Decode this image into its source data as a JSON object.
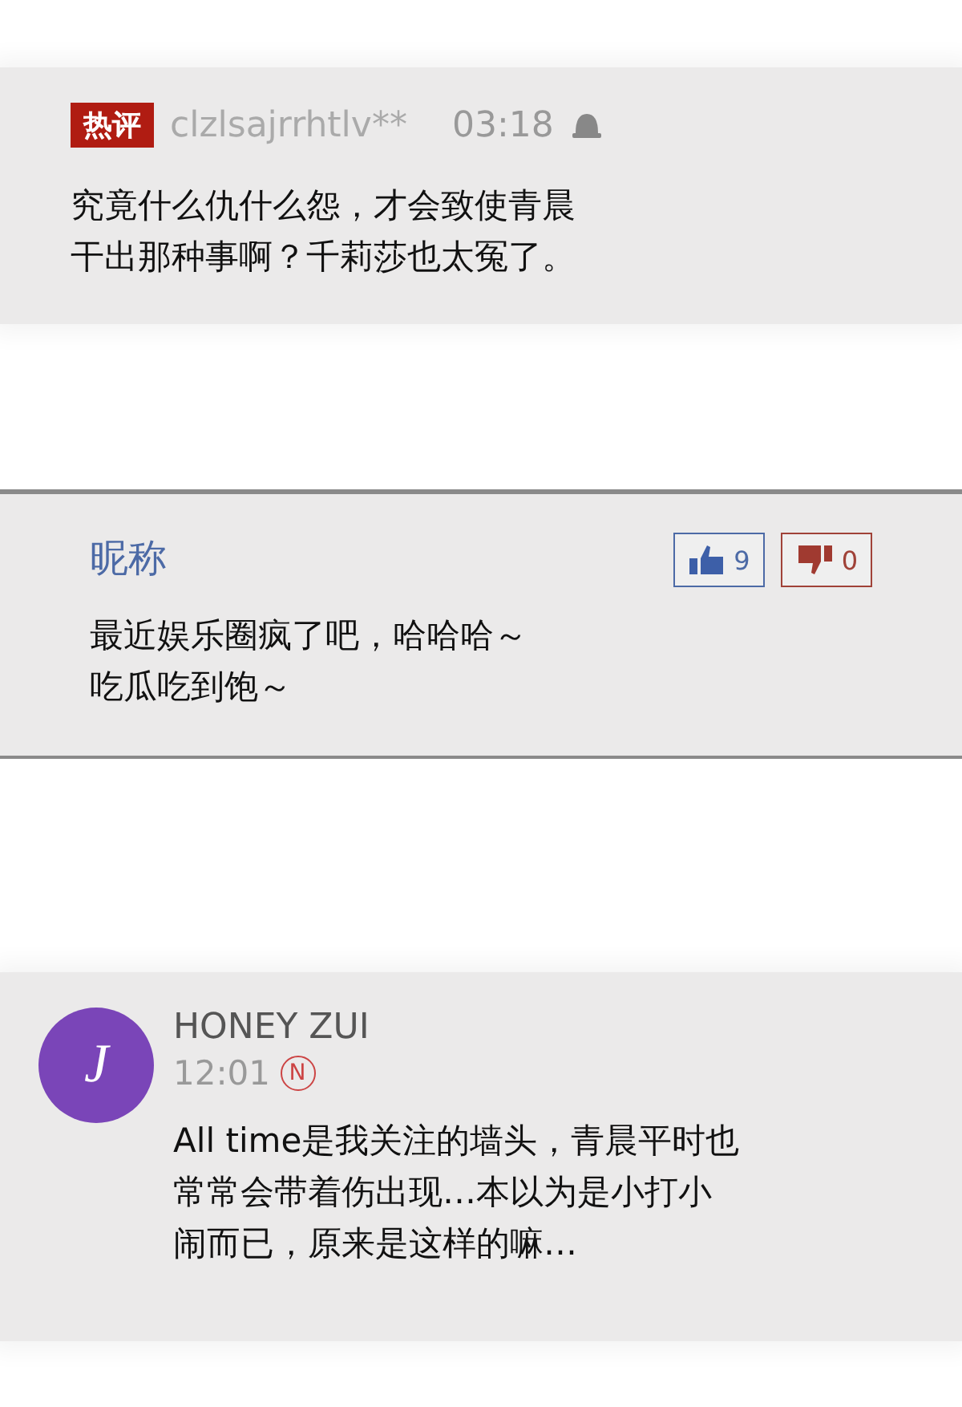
{
  "comments": [
    {
      "kind": "hot",
      "badge": "热评",
      "user": "clzlsajrrhtlv**",
      "time": "03:18",
      "text": "究竟什么仇什么怨，才会致使青晨干出那种事啊？千莉莎也太冤了。"
    },
    {
      "kind": "voted",
      "user": "昵称",
      "likes": "9",
      "dislikes": "0",
      "text": "最近娱乐圈疯了吧，哈哈哈～吃瓜吃到饱～"
    },
    {
      "kind": "avatar",
      "avatar_letter": "J",
      "color": "#7a45b8",
      "user": "HONEY ZUI",
      "time": "12:01",
      "new_mark": "N",
      "text": "All time是我关注的墙头，青晨平时也常常会带着伤出现…本以为是小打小闹而已，原来是这样的嘛…"
    }
  ]
}
